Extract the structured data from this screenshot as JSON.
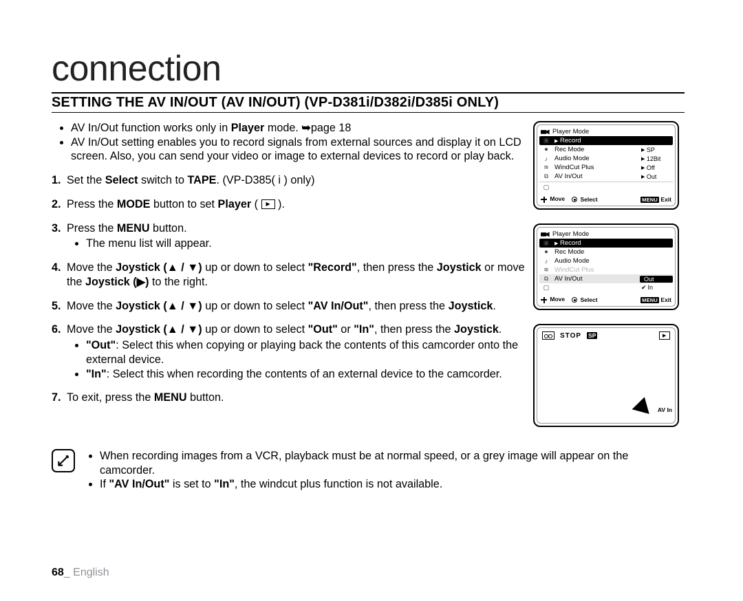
{
  "page": {
    "title": "connection",
    "subhead": "SETTING THE AV IN/OUT (AV IN/OUT) (VP-D381i/D382i/D385i ONLY)",
    "number": "68",
    "language": "English"
  },
  "intro": {
    "b1a": "AV In/Out function works only in ",
    "b1b": "Player",
    "b1c": " mode. ",
    "b1d": "page 18",
    "b2": "AV In/Out setting enables you to record signals from external sources and display it on LCD screen. Also, you can send your video or image to external devices to record or play back."
  },
  "steps": {
    "s1a": "Set the ",
    "s1b": "Select",
    "s1c": " switch to ",
    "s1d": "TAPE",
    "s1e": ". (VP-D385( i ) only)",
    "s2a": "Press the ",
    "s2b": "MODE",
    "s2c": " button to set ",
    "s2d": "Player",
    "s2e": " ( ",
    "s2f": " ).",
    "s3a": "Press the ",
    "s3b": "MENU",
    "s3c": " button.",
    "s3sub": "The menu list will appear.",
    "s4a": "Move the ",
    "s4b": "Joystick (▲ / ▼)",
    "s4c": " up or down to select ",
    "s4d": "\"Record\"",
    "s4e": ", then press the ",
    "s4f": "Joystick",
    "s4g": " or move the ",
    "s4h": "Joystick (▶)",
    "s4i": " to the right.",
    "s5a": "Move the ",
    "s5b": "Joystick (▲ / ▼)",
    "s5c": " up or down to select ",
    "s5d": "\"AV In/Out\"",
    "s5e": ", then press the ",
    "s5f": "Joystick",
    "s5g": ".",
    "s6a": "Move the ",
    "s6b": "Joystick (▲ / ▼)",
    "s6c": " up or down to select ",
    "s6d": "\"Out\"",
    "s6e": " or ",
    "s6f": "\"In\"",
    "s6g": ", then press the ",
    "s6h": "Joystick",
    "s6i": ".",
    "s6sub1a": "\"Out\"",
    "s6sub1b": ": Select this when copying or playing back the contents of this camcorder onto the external device.",
    "s6sub2a": "\"In\"",
    "s6sub2b": ": Select this when recording the contents of an external device to the camcorder.",
    "s7a": "To exit, press the ",
    "s7b": "MENU",
    "s7c": " button."
  },
  "notes": {
    "n1": "When recording images from a VCR, playback must be at normal speed, or a grey image will appear on the camcorder.",
    "n2a": "If ",
    "n2b": "\"AV In/Out\"",
    "n2c": " is set to ",
    "n2d": "\"In\"",
    "n2e": ", the windcut plus function is not available."
  },
  "osd1": {
    "header": "Player Mode",
    "rows": [
      {
        "label": "Record",
        "hl": true
      },
      {
        "label": "Rec Mode",
        "val": "SP"
      },
      {
        "label": "Audio Mode",
        "val": "12Bit"
      },
      {
        "label": "WindCut Plus",
        "val": "Off"
      },
      {
        "label": "AV In/Out",
        "val": "Out"
      }
    ],
    "footer": {
      "move": "Move",
      "select": "Select",
      "menu": "MENU",
      "exit": "Exit"
    }
  },
  "osd2": {
    "header": "Player Mode",
    "rows": [
      {
        "label": "Record",
        "hl": true
      },
      {
        "label": "Rec Mode"
      },
      {
        "label": "Audio Mode"
      },
      {
        "label": "WindCut Plus",
        "dim": true
      },
      {
        "label": "AV In/Out",
        "val": "Out",
        "sel": true
      },
      {
        "label": "In",
        "sub": true,
        "check": true
      }
    ],
    "footer": {
      "move": "Move",
      "select": "Select",
      "menu": "MENU",
      "exit": "Exit"
    }
  },
  "osd3": {
    "stop": "STOP",
    "chip": "SP",
    "avin": "AV In"
  }
}
